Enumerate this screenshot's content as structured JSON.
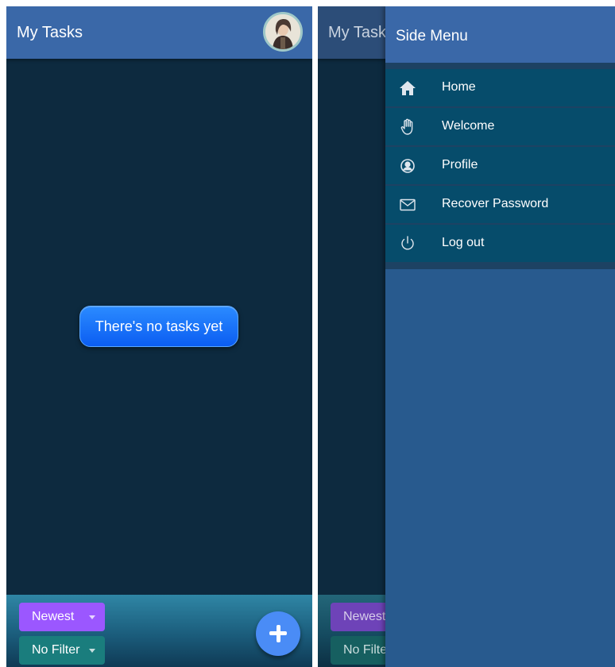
{
  "main_screen": {
    "app_title": "My Tasks",
    "empty_message": "There's no tasks yet",
    "sort_chip": {
      "label": "Newest"
    },
    "filter_chip": {
      "label": "No Filter"
    },
    "add_button": {
      "icon": "plus-icon"
    },
    "avatar": {
      "icon": "user-avatar"
    }
  },
  "drawer_screen": {
    "background_title": "My Task",
    "background_sort_label": "Newest",
    "background_filter_label": "No Filte",
    "drawer": {
      "title": "Side Menu",
      "items": [
        {
          "label": "Home",
          "icon": "home-icon"
        },
        {
          "label": "Welcome",
          "icon": "hand-icon"
        },
        {
          "label": "Profile",
          "icon": "profile-icon"
        },
        {
          "label": "Recover Password",
          "icon": "mail-icon"
        },
        {
          "label": "Log out",
          "icon": "power-icon"
        }
      ]
    }
  },
  "colors": {
    "app_bar": "#3a68a8",
    "body_background": "#0d2a3f",
    "empty_pill": "#0b5df2",
    "sort_chip": "#9b57ff",
    "filter_chip": "#1a7d7d",
    "fab": "#4a8cf6",
    "menu_item": "#064c6b",
    "drawer": "#285a8e"
  }
}
